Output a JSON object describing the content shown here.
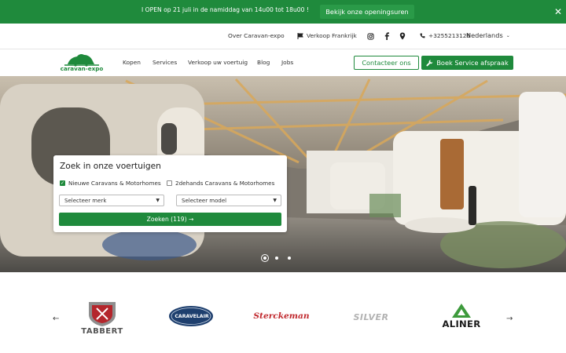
{
  "announcement": {
    "text": "I OPEN op 21 juli in de namiddag van 14u00 tot 18u00 !",
    "button": "Bekijk onze openingsuren",
    "close": "✕"
  },
  "utility": {
    "about": "Over Caravan-expo",
    "sales_france": "Verkoop Frankrijk",
    "phone": "+3255213126",
    "language": "Nederlands"
  },
  "nav": {
    "logo_text": "caravan-expo",
    "links": [
      "Kopen",
      "Services",
      "Verkoop uw voertuig",
      "Blog",
      "Jobs"
    ],
    "contact_button": "Contacteer ons",
    "service_button": "Boek Service afspraak"
  },
  "search": {
    "title": "Zoek in onze voertuigen",
    "option_new": "Nieuwe Caravans & Motorhomes",
    "option_used": "2dehands Caravans & Motorhomes",
    "option_new_checked": true,
    "option_used_checked": false,
    "select_brand": "Selecteer merk",
    "select_model": "Selecteer model",
    "submit": "Zoeken (119) →"
  },
  "carousel": {
    "slides": 3,
    "active": 1
  },
  "brands": {
    "items": [
      "TABBERT",
      "CARAVELAIR",
      "Sterckeman",
      "SILVER",
      "ALINER"
    ],
    "prev": "←",
    "next": "→"
  },
  "colors": {
    "brand_green": "#1f8a3c"
  }
}
